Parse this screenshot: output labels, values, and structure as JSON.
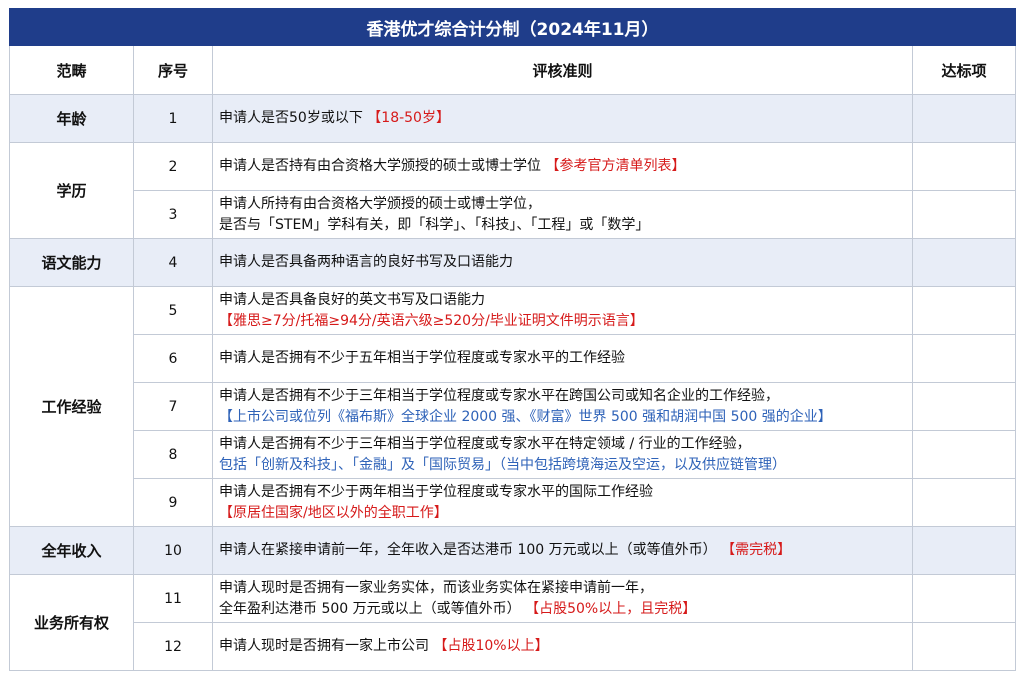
{
  "title": "香港优才综合计分制（2024年11月）",
  "headers": {
    "category": "范畴",
    "number": "序号",
    "criteria": "评核准则",
    "met": "达标项"
  },
  "rows": [
    {
      "category": "年龄",
      "number": "1",
      "text": "申请人是否50岁或以下",
      "note": "【18-50岁】",
      "note_color": "red"
    },
    {
      "category": "学历",
      "number": "2",
      "text": "申请人是否持有由合资格大学颁授的硕士或博士学位",
      "note": "【参考官方清单列表】",
      "note_color": "red"
    },
    {
      "number": "3",
      "text": "申请人所持有由合资格大学颁授的硕士或博士学位，",
      "text2": "是否与「STEM」学科有关，即「科学」、「科技」、「工程」或「数学」"
    },
    {
      "category": "语文能力",
      "number": "4",
      "text": "申请人是否具备两种语言的良好书写及口语能力"
    },
    {
      "category": "工作经验",
      "number": "5",
      "text": "申请人是否具备良好的英文书写及口语能力",
      "note": "【雅思≥7分/托福≥94分/英语六级≥520分/毕业证明文件明示语言】",
      "note_color": "red"
    },
    {
      "number": "6",
      "text": "申请人是否拥有不少于五年相当于学位程度或专家水平的工作经验"
    },
    {
      "number": "7",
      "text": "申请人是否拥有不少于三年相当于学位程度或专家水平在跨国公司或知名企业的工作经验，",
      "note": "【上市公司或位列《福布斯》全球企业 2000 强、《财富》世界 500 强和胡润中国 500 强的企业】",
      "note_color": "blue"
    },
    {
      "number": "8",
      "text": "申请人是否拥有不少于三年相当于学位程度或专家水平在特定领域 / 行业的工作经验，",
      "note": "包括「创新及科技」、「金融」及「国际贸易」（当中包括跨境海运及空运，以及供应链管理）",
      "note_color": "blue"
    },
    {
      "number": "9",
      "text": "申请人是否拥有不少于两年相当于学位程度或专家水平的国际工作经验",
      "note": "【原居住国家/地区以外的全职工作】",
      "note_color": "red"
    },
    {
      "category": "全年收入",
      "number": "10",
      "text": "申请人在紧接申请前一年，全年收入是否达港币 100 万元或以上（或等值外币）",
      "note": "【需完税】",
      "note_color": "red"
    },
    {
      "category": "业务所有权",
      "number": "11",
      "text": "申请人现时是否拥有一家业务实体，而该业务实体在紧接申请前一年，",
      "text2": "全年盈利达港币 500 万元或以上（或等值外币）",
      "note": "【占股50%以上，且完税】",
      "note_color": "red"
    },
    {
      "number": "12",
      "text": "申请人现时是否拥有一家上市公司",
      "note": "【占股10%以上】",
      "note_color": "red"
    }
  ]
}
